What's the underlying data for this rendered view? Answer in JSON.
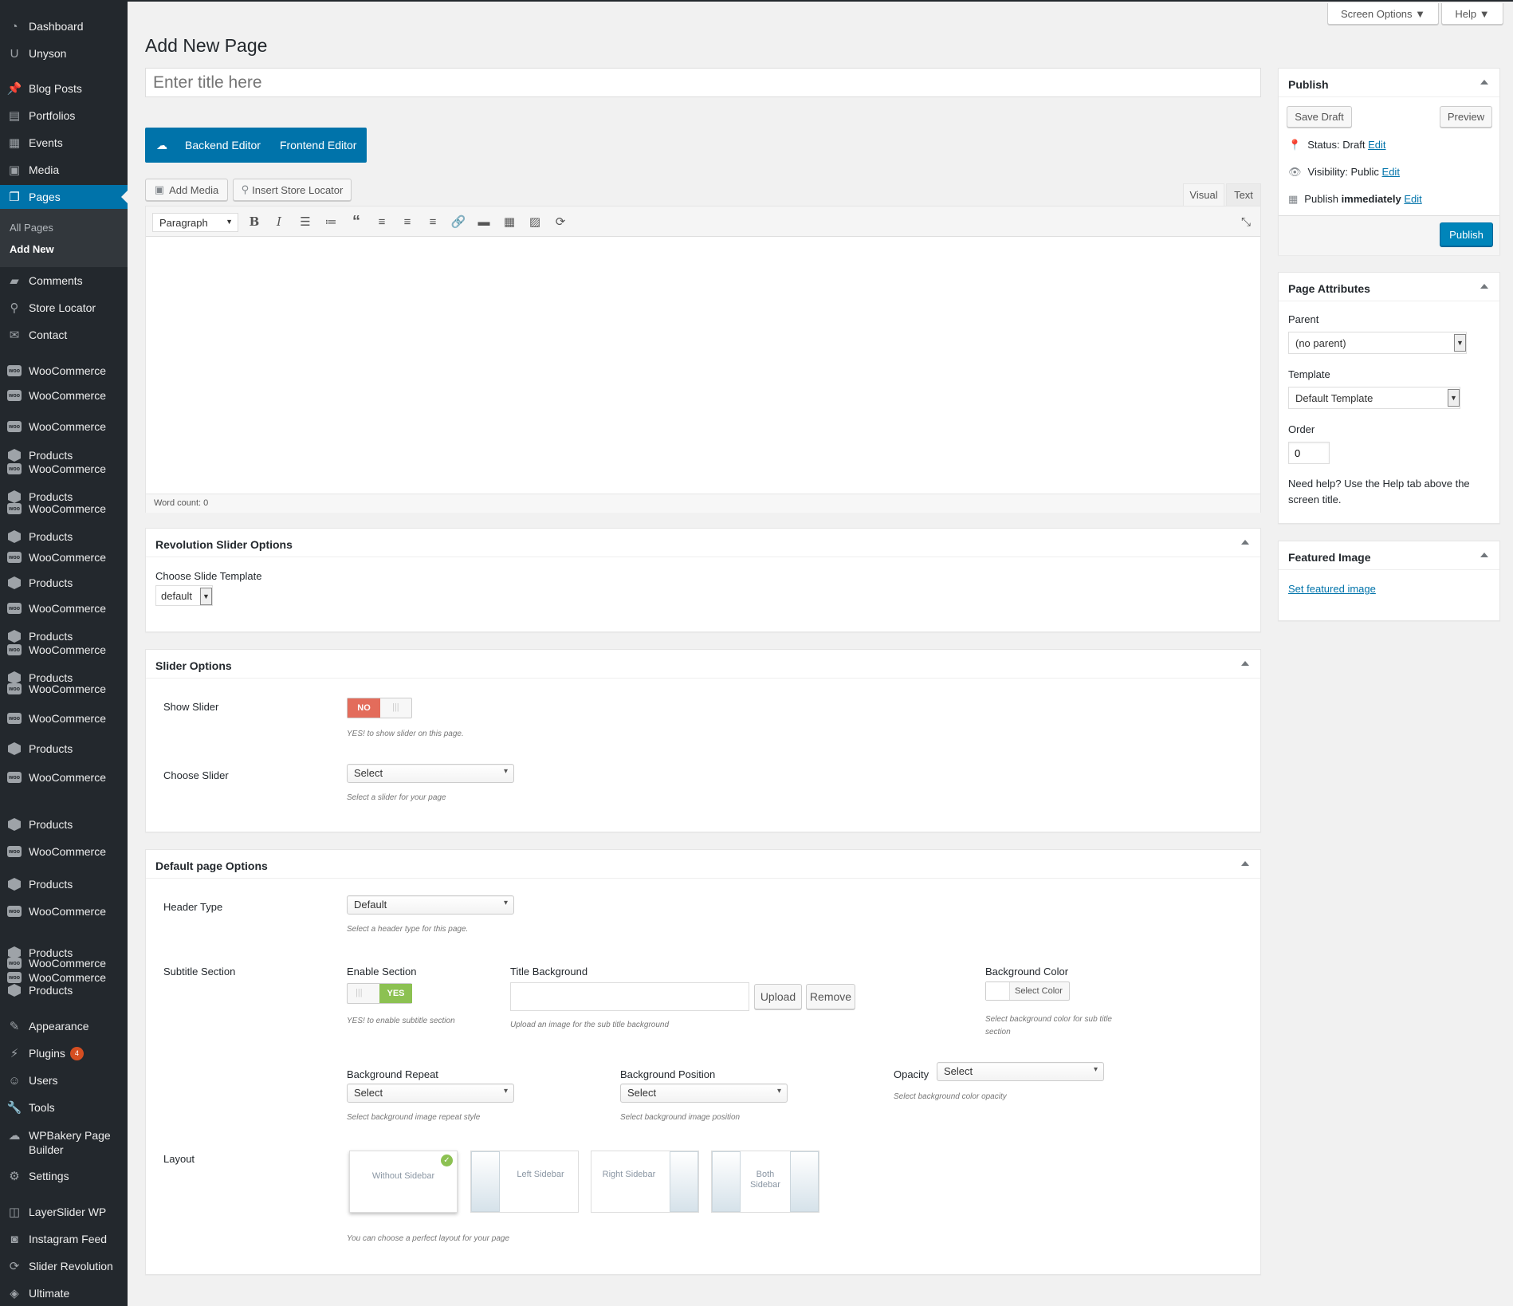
{
  "top": {
    "screen_options": "Screen Options",
    "help": "Help"
  },
  "page_title": "Add New Page",
  "title_placeholder": "Enter title here",
  "builder": {
    "backend": "Backend Editor",
    "frontend": "Frontend Editor"
  },
  "media": {
    "add_media": "Add Media",
    "store_locator": "Insert Store Locator"
  },
  "editor": {
    "tab_visual": "Visual",
    "tab_text": "Text",
    "format": "Paragraph",
    "word_count": "Word count: 0"
  },
  "sidebar": {
    "items": [
      {
        "label": "Dashboard",
        "icon": "dashboard-icon"
      },
      {
        "label": "Unyson",
        "icon": "unyson-icon"
      },
      {
        "label": "Blog Posts",
        "icon": "pin-icon"
      },
      {
        "label": "Portfolios",
        "icon": "portfolio-icon"
      },
      {
        "label": "Events",
        "icon": "calendar-icon"
      },
      {
        "label": "Media",
        "icon": "media-icon"
      },
      {
        "label": "Pages",
        "icon": "pages-icon",
        "active": true
      },
      {
        "label": "Comments",
        "icon": "comment-icon"
      },
      {
        "label": "Store Locator",
        "icon": "location-icon"
      },
      {
        "label": "Contact",
        "icon": "mail-icon"
      },
      {
        "label": "WooCommerce",
        "icon": "woo-icon"
      },
      {
        "label": "WooCommerce",
        "icon": "woo-icon"
      },
      {
        "label": "WooCommerce",
        "icon": "woo-icon"
      },
      {
        "label": "Products",
        "icon": "cube-icon"
      },
      {
        "label": "WooCommerce",
        "icon": "woo-icon"
      },
      {
        "label": "Products",
        "icon": "cube-icon"
      },
      {
        "label": "WooCommerce",
        "icon": "woo-icon"
      },
      {
        "label": "Products",
        "icon": "cube-icon"
      },
      {
        "label": "WooCommerce",
        "icon": "woo-icon"
      },
      {
        "label": "Products",
        "icon": "cube-icon"
      },
      {
        "label": "WooCommerce",
        "icon": "woo-icon"
      },
      {
        "label": "Products",
        "icon": "cube-icon"
      },
      {
        "label": "WooCommerce",
        "icon": "woo-icon"
      },
      {
        "label": "Products",
        "icon": "cube-icon"
      },
      {
        "label": "WooCommerce",
        "icon": "woo-icon"
      },
      {
        "label": "WooCommerce",
        "icon": "woo-icon"
      },
      {
        "label": "Products",
        "icon": "cube-icon"
      },
      {
        "label": "WooCommerce",
        "icon": "woo-icon"
      },
      {
        "label": "Products",
        "icon": "cube-icon"
      },
      {
        "label": "WooCommerce",
        "icon": "woo-icon"
      },
      {
        "label": "Products",
        "icon": "cube-icon"
      },
      {
        "label": "WooCommerce",
        "icon": "woo-icon"
      },
      {
        "label": "Products",
        "icon": "cube-icon"
      },
      {
        "label": "WooCommerce",
        "icon": "woo-icon"
      },
      {
        "label": "WooCommerce",
        "icon": "woo-icon"
      },
      {
        "label": "Products",
        "icon": "cube-icon"
      },
      {
        "label": "Appearance",
        "icon": "brush-icon"
      },
      {
        "label": "Plugins",
        "icon": "plugin-icon",
        "badge": "4"
      },
      {
        "label": "Users",
        "icon": "user-icon"
      },
      {
        "label": "Tools",
        "icon": "wrench-icon"
      },
      {
        "label": "WPBakery Page Builder",
        "icon": "bakery-icon"
      },
      {
        "label": "Settings",
        "icon": "settings-icon"
      },
      {
        "label": "LayerSlider WP",
        "icon": "layers-icon"
      },
      {
        "label": "Instagram Feed",
        "icon": "camera-icon"
      },
      {
        "label": "Slider Revolution",
        "icon": "refresh-icon"
      },
      {
        "label": "Ultimate",
        "icon": "shield-icon"
      }
    ],
    "sub": {
      "all_pages": "All Pages",
      "add_new": "Add New"
    }
  },
  "publish": {
    "title": "Publish",
    "save_draft": "Save Draft",
    "preview": "Preview",
    "status_label": "Status:",
    "status_value": "Draft",
    "visibility_label": "Visibility:",
    "visibility_value": "Public",
    "schedule_label": "Publish",
    "schedule_value": "immediately",
    "edit": "Edit",
    "publish_btn": "Publish"
  },
  "attributes": {
    "title": "Page Attributes",
    "parent_label": "Parent",
    "parent_value": "(no parent)",
    "template_label": "Template",
    "template_value": "Default Template",
    "order_label": "Order",
    "order_value": "0",
    "help": "Need help? Use the Help tab above the screen title."
  },
  "featured": {
    "title": "Featured Image",
    "link": "Set featured image"
  },
  "revslider": {
    "title": "Revolution Slider Options",
    "label": "Choose Slide Template",
    "value": "default"
  },
  "slider_options": {
    "title": "Slider Options",
    "show_label": "Show Slider",
    "toggle_no": "NO",
    "show_hint": "YES! to show slider on this page.",
    "choose_label": "Choose Slider",
    "choose_value": "Select",
    "choose_hint": "Select a slider for your page"
  },
  "default_options": {
    "title": "Default page Options",
    "header_label": "Header Type",
    "header_value": "Default",
    "header_hint": "Select a header type for this page.",
    "subtitle_label": "Subtitle Section",
    "enable_label": "Enable Section",
    "toggle_yes": "YES",
    "enable_hint": "YES! to enable subtitle section",
    "title_bg_label": "Title Background",
    "upload": "Upload",
    "remove": "Remove",
    "title_bg_hint": "Upload an image for the sub title background",
    "bg_color_label": "Background Color",
    "select_color": "Select Color",
    "bg_color_hint": "Select background color for sub title section",
    "bg_repeat_label": "Background Repeat",
    "bg_repeat_value": "Select",
    "bg_repeat_hint": "Select background image repeat style",
    "bg_pos_label": "Background Position",
    "bg_pos_value": "Select",
    "bg_pos_hint": "Select background image position",
    "opacity_label": "Opacity",
    "opacity_value": "Select",
    "opacity_hint": "Select background color opacity",
    "layout_label": "Layout",
    "layouts": [
      "Without Sidebar",
      "Left Sidebar",
      "Right Sidebar",
      "Both Sidebar"
    ],
    "layout_hint": "You can choose a perfect layout for your page"
  }
}
